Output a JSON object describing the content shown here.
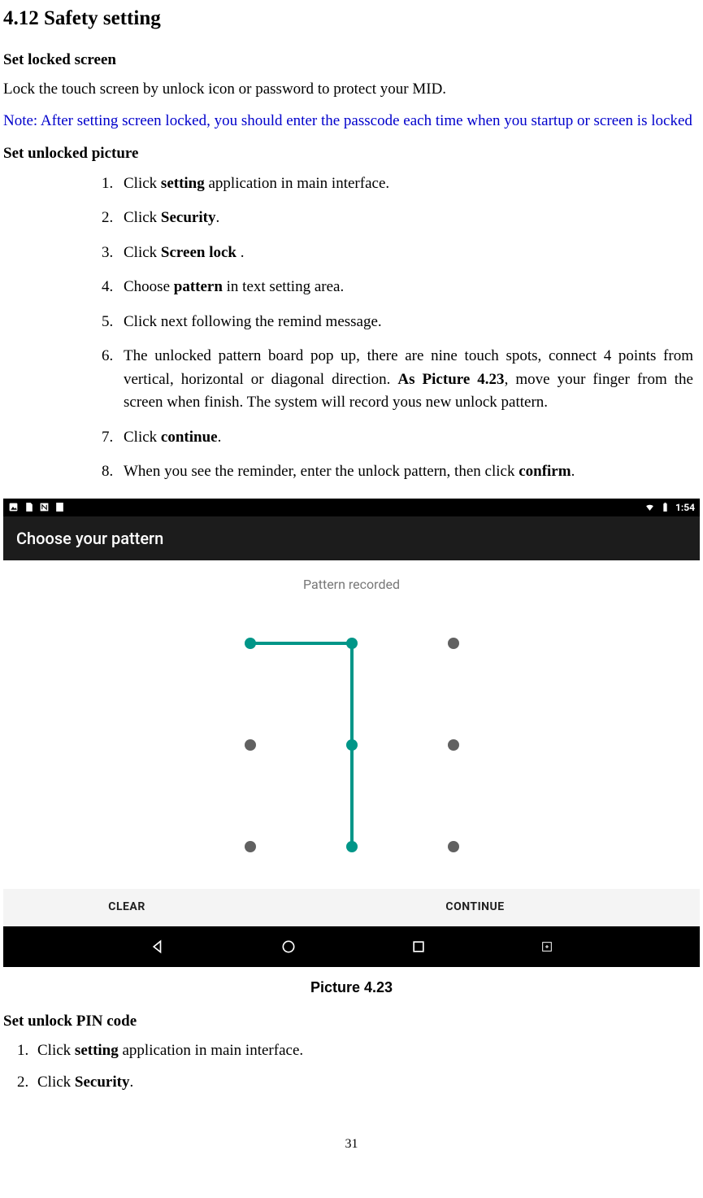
{
  "section_title": "4.12 Safety setting",
  "heading_locked": "Set locked screen",
  "para_lock": "Lock the touch screen by unlock icon or password to protect your MID.",
  "note_text": "Note: After setting screen locked, you should enter the passcode each time when you startup or screen is locked",
  "heading_picture": "Set unlocked picture",
  "steps_picture": {
    "s1_pre": "Click ",
    "s1_b": "setting",
    "s1_post": " application in main interface.",
    "s2_pre": "Click ",
    "s2_b": "Security",
    "s2_post": ".",
    "s3_pre": "Click ",
    "s3_b": "Screen lock ",
    "s3_post": ".",
    "s4_pre": "Choose ",
    "s4_b": "pattern",
    "s4_post": " in text setting area.",
    "s5": "Click next following the remind message.",
    "s6_pre": "The unlocked pattern board pop up, there are nine touch spots, connect 4 points from vertical, horizontal or diagonal direction. ",
    "s6_b": "As Picture 4.23",
    "s6_post": ", move your finger from the screen when finish. The system will record yous new unlock pattern.",
    "s7_pre": "Click ",
    "s7_b": "continue",
    "s7_post": ".",
    "s8_pre": "When you see the reminder, enter the unlock pattern, then click ",
    "s8_b": "confirm",
    "s8_post": "."
  },
  "screenshot": {
    "time": "1:54",
    "title": "Choose your pattern",
    "message": "Pattern recorded",
    "clear": "CLEAR",
    "continue": "CONTINUE"
  },
  "caption": "Picture 4.23",
  "heading_pin": "Set unlock PIN code",
  "steps_pin": {
    "s1_pre": "Click ",
    "s1_b": "setting",
    "s1_post": " application in main interface.",
    "s2_pre": "Click ",
    "s2_b": "Security",
    "s2_post": "."
  },
  "page_number": "31"
}
